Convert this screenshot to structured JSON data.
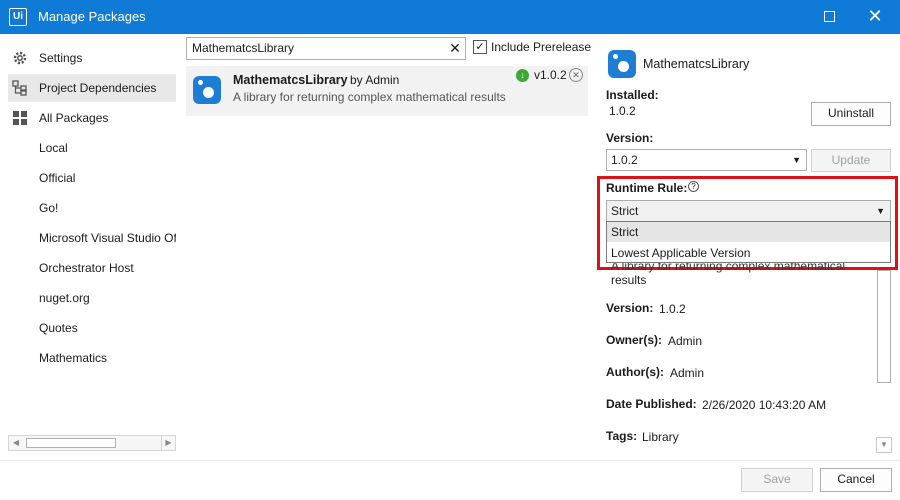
{
  "window": {
    "app_icon": "Ui",
    "title": "Manage Packages",
    "maximize_icon": "maximize-icon",
    "close_icon": "close-icon"
  },
  "sidebar": {
    "items": [
      {
        "label": "Settings",
        "icon": "gear-icon"
      },
      {
        "label": "Project Dependencies",
        "icon": "dependencies-icon"
      },
      {
        "label": "All Packages",
        "icon": "grid-icon"
      },
      {
        "label": "Local"
      },
      {
        "label": "Official"
      },
      {
        "label": "Go!"
      },
      {
        "label": "Microsoft Visual Studio Of"
      },
      {
        "label": "Orchestrator Host"
      },
      {
        "label": "nuget.org"
      },
      {
        "label": "Quotes"
      },
      {
        "label": "Mathematics"
      }
    ],
    "selected": "Project Dependencies"
  },
  "search": {
    "value": "MathematcsLibrary",
    "clear_icon": "close-icon"
  },
  "prerelease": {
    "label": "Include Prerelease",
    "checked": true,
    "check_mark": "✓"
  },
  "package_list": [
    {
      "name": "MathematcsLibrary",
      "by": "by  Admin",
      "description": "A library for returning complex mathematical results",
      "version": "v1.0.2"
    }
  ],
  "details": {
    "title": "MathematcsLibrary",
    "installed_label": "Installed:",
    "installed_value": "1.0.2",
    "uninstall_label": "Uninstall",
    "version_label": "Version:",
    "version_selected": "1.0.2",
    "update_label": "Update",
    "runtime_rule_label": "Runtime Rule:",
    "runtime_rule_help": "?",
    "runtime_rule_selected": "Strict",
    "runtime_rule_options": [
      "Strict",
      "Lowest Applicable Version"
    ],
    "description_partial": "A library for returning complex mathematical",
    "description_tail": "results",
    "version2_label": "Version:",
    "version2_value": "1.0.2",
    "owners_label": "Owner(s):",
    "owners_value": "Admin",
    "authors_label": "Author(s):",
    "authors_value": "Admin",
    "date_label": "Date Published:",
    "date_value": "2/26/2020 10:43:20 AM",
    "tags_label": "Tags:",
    "tags_value": "Library"
  },
  "footer": {
    "save_label": "Save",
    "cancel_label": "Cancel"
  },
  "colors": {
    "titlebar": "#0f7bd6",
    "highlight": "#e0101a",
    "package_icon": "#1e7ed4",
    "installed_badge": "#3aaa35"
  }
}
